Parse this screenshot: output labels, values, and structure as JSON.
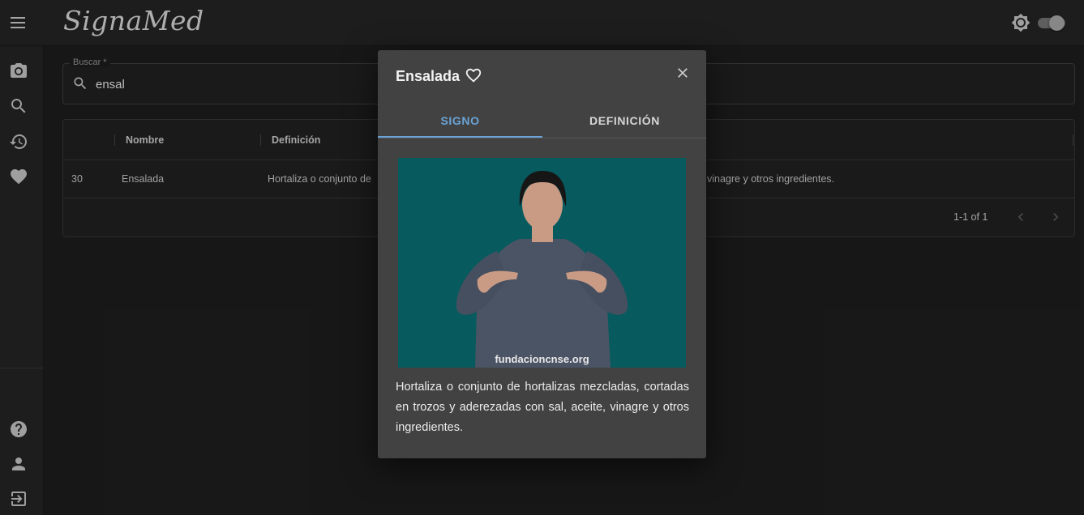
{
  "app": {
    "title": "SignaMed"
  },
  "search": {
    "label": "Buscar *",
    "value": "ensal"
  },
  "table": {
    "headers": [
      "",
      "Nombre",
      "Definición"
    ],
    "rows": [
      {
        "id": "30",
        "name": "Ensalada",
        "definition_left": "Hortaliza o conjunto de",
        "definition_right": "vinagre y otros ingredientes."
      }
    ],
    "pagination": "1-1 of 1"
  },
  "dialog": {
    "title": "Ensalada",
    "tabs": [
      "SIGNO",
      "DEFINICIÓN"
    ],
    "video_watermark": "fundacioncnse.org",
    "definition": "Hortaliza o conjunto de hortalizas mezcladas, cortadas en trozos y aderezadas con sal, aceite, vinagre y otros ingredientes."
  },
  "colors": {
    "accent": "#6aa3d6",
    "video_bg": "#075a5e",
    "dialog_bg": "#424242"
  }
}
